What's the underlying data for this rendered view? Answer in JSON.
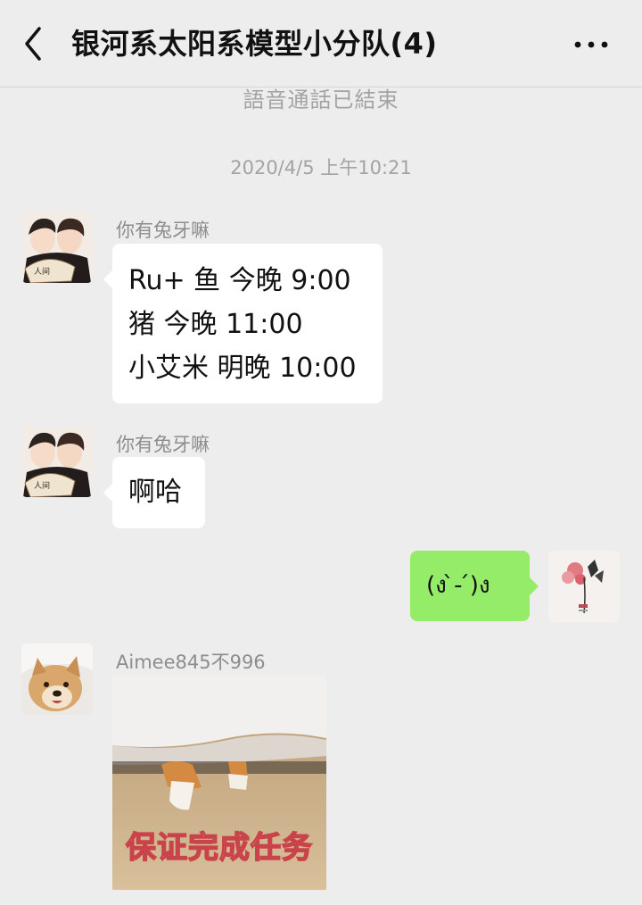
{
  "header": {
    "title": "银河系太阳系模型小分队(4)",
    "back_icon": "chevron-left-icon",
    "more_icon": "more-horizontal-icon"
  },
  "system": {
    "call_ended": "語音通話已結束",
    "timestamp": "2020/4/5 上午10:21"
  },
  "messages": [
    {
      "sender": "你有兔牙嘛",
      "side": "left",
      "lines": [
        "Ru+ 鱼 今晚 9:00",
        "猪 今晚 11:00",
        "小艾米 明晚 10:00"
      ]
    },
    {
      "sender": "你有兔牙嘛",
      "side": "left",
      "lines": [
        "啊哈"
      ]
    },
    {
      "sender": "",
      "side": "right",
      "lines": [
        "(ง ̀-  ́)ง"
      ]
    },
    {
      "sender": "Aimee845不996",
      "side": "left",
      "sticker_caption": "保证完成任务"
    }
  ],
  "colors": {
    "background": "#ededed",
    "my_bubble": "#95ec69",
    "other_bubble": "#ffffff",
    "meta_text": "#a3a3a3"
  }
}
